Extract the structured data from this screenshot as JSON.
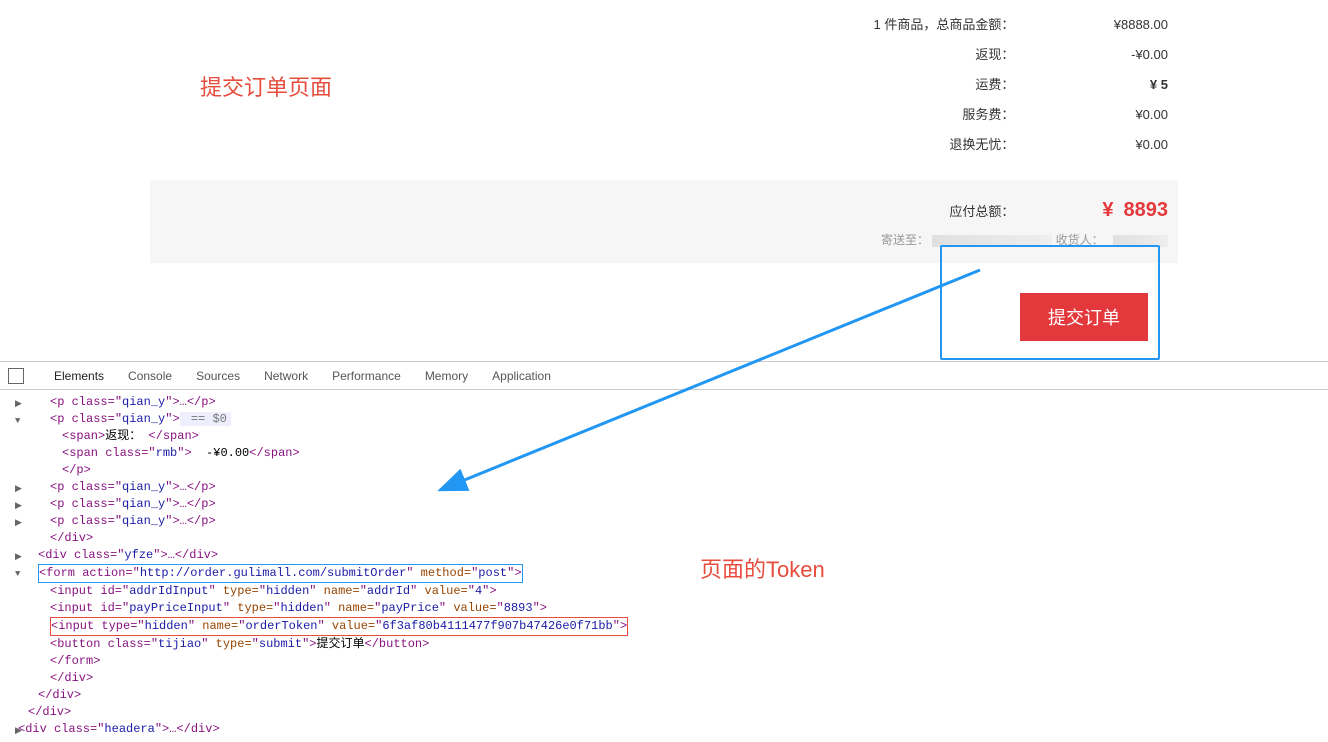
{
  "annotations": {
    "page_title": "提交订单页面",
    "token_label": "页面的Token"
  },
  "summary": {
    "items_count_label": "1 件商品，总商品金额：",
    "items_total": "¥8888.00",
    "cashback_label": "返现：",
    "cashback": "-¥0.00",
    "shipping_label": "运费：",
    "shipping": "¥ 5",
    "service_label": "服务费：",
    "service": "¥0.00",
    "return_label": "退换无忧：",
    "return": "¥0.00"
  },
  "total": {
    "label": "应付总额：",
    "yen": "¥",
    "value": "8893",
    "deliver_prefix": "寄送至：",
    "receiver_prefix": "收货人："
  },
  "submit_btn": "提交订单",
  "devtools": {
    "tabs": [
      "Elements",
      "Console",
      "Sources",
      "Network",
      "Performance",
      "Memory",
      "Application"
    ]
  },
  "dom": {
    "line0": {
      "pre": "<p class=",
      "cls": "qian_y",
      "post": ">…</p>"
    },
    "line1": {
      "pre": "<p class=",
      "cls": "qian_y",
      "post": ">",
      "sel": " == $0"
    },
    "line1a_open": "<span>",
    "line1a_text": "返现：",
    "line1a_close": " </span>",
    "line1b_open": "<span class=",
    "line1b_cls": "rmb",
    "line1b_mid": ">  ",
    "line1b_text": "-¥0.00",
    "line1b_close": "</span>",
    "line1c": "</p>",
    "line2": {
      "pre": "<p class=",
      "cls": "qian_y",
      "post": ">…</p>"
    },
    "line3": {
      "pre": "<p class=",
      "cls": "qian_y",
      "post": ">…</p>"
    },
    "line4": {
      "pre": "<p class=",
      "cls": "qian_y",
      "post": ">…</p>"
    },
    "line5": "</div>",
    "line6": {
      "pre": "<div class=",
      "cls": "yfze",
      "post": ">…</div>"
    },
    "form_open_pre": "<form action=",
    "form_action": "http://order.gulimall.com/submitOrder",
    "form_mid": " method=",
    "form_method": "post",
    "form_end": ">",
    "input1_pre": "<input id=",
    "input1_id": "addrIdInput",
    "input1_a": " type=",
    "input1_type": "hidden",
    "input1_b": " name=",
    "input1_name": "addrId",
    "input1_c": " value=",
    "input1_val": "4",
    "input1_end": ">",
    "input2_pre": "<input id=",
    "input2_id": "payPriceInput",
    "input2_a": " type=",
    "input2_type": "hidden",
    "input2_b": " name=",
    "input2_name": "payPrice",
    "input2_c": " value=",
    "input2_val": "8893",
    "input2_end": ">",
    "input3_pre": "<input type=",
    "input3_type": "hidden",
    "input3_a": " name=",
    "input3_name": "orderToken",
    "input3_b": " value=",
    "input3_val": "6f3af80b4111477f907b47426e0f71bb",
    "input3_end": ">",
    "btn_pre": "<button class=",
    "btn_cls": "tijiao",
    "btn_a": " type=",
    "btn_type": "submit",
    "btn_mid": ">",
    "btn_text": "提交订单",
    "btn_close": "</button>",
    "form_close": "</form>",
    "div_close1": "</div>",
    "div_close2": "</div>",
    "div_close3": "</div>",
    "headera_pre": "<div class=",
    "headera_cls": "headera",
    "headera_post": ">…</div>"
  }
}
